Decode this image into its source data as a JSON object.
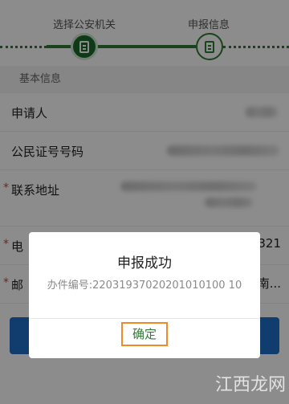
{
  "stepper": {
    "steps": [
      {
        "label": "选择公安机关"
      },
      {
        "label": "申报信息"
      }
    ]
  },
  "form": {
    "section_title": "基本信息",
    "fields": [
      {
        "label": "申请人",
        "required": false
      },
      {
        "label": "公民证号号码",
        "required": false
      },
      {
        "label": "联系地址",
        "required": true
      },
      {
        "label": "电",
        "required": true,
        "visible_value_tail": "321"
      },
      {
        "label": "邮",
        "required": true,
        "visible_value_tail": "南..."
      }
    ],
    "required_mark": "*"
  },
  "dialog": {
    "title": "申报成功",
    "message": "办件编号:22031937020201010100 10",
    "confirm_label": "确定"
  },
  "watermark": "江西龙网",
  "colors": {
    "accent_green": "#2e7d32",
    "primary_blue": "#1e6ec8",
    "highlight_orange": "#f08a24",
    "required_red": "#e53935"
  }
}
